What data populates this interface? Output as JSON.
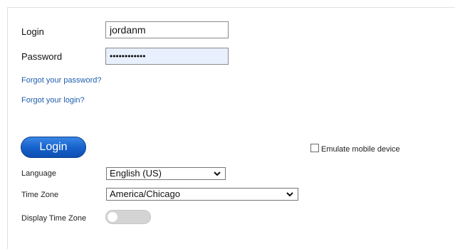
{
  "form": {
    "login_label": "Login",
    "login_value": "jordanm",
    "password_label": "Password",
    "password_value": "••••••••••••",
    "forgot_password": "Forgot your password?",
    "forgot_login": "Forgot your login?",
    "login_button": "Login",
    "emulate_mobile_label": "Emulate mobile device",
    "emulate_mobile_checked": false,
    "language_label": "Language",
    "language_value": "English (US)",
    "timezone_label": "Time Zone",
    "timezone_value": "America/Chicago",
    "display_timezone_label": "Display Time Zone",
    "display_timezone_on": false
  },
  "icons": {
    "select_arrow": "chevron-down-icon"
  }
}
